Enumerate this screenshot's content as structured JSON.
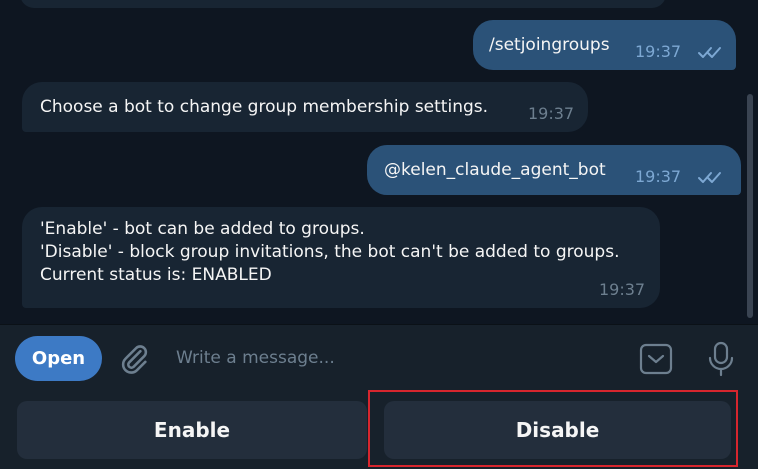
{
  "messages": [
    {
      "direction": "out",
      "text": "/setjoingroups",
      "time": "19:37",
      "read": true
    },
    {
      "direction": "in",
      "text": "Choose a bot to change group membership settings.",
      "time": "19:37"
    },
    {
      "direction": "out",
      "text": "@kelen_claude_agent_bot",
      "time": "19:37",
      "read": true
    },
    {
      "direction": "in",
      "lines": [
        "'Enable' - bot can be added to groups.",
        "'Disable' - block group invitations, the bot can't be added to groups.",
        "Current status is: ENABLED"
      ],
      "time": "19:37"
    }
  ],
  "composer": {
    "open_label": "Open",
    "placeholder": "Write a message...",
    "attach_icon": "paperclip-icon",
    "keyboard_icon": "bot-keyboard-icon",
    "mic_icon": "microphone-icon"
  },
  "keyboard": {
    "buttons": [
      "Enable",
      "Disable"
    ]
  },
  "colors": {
    "background": "#0e1621",
    "incoming_bubble": "#182533",
    "outgoing_bubble": "#2b5278",
    "accent": "#3d7ac5",
    "highlight": "#d7262e"
  }
}
